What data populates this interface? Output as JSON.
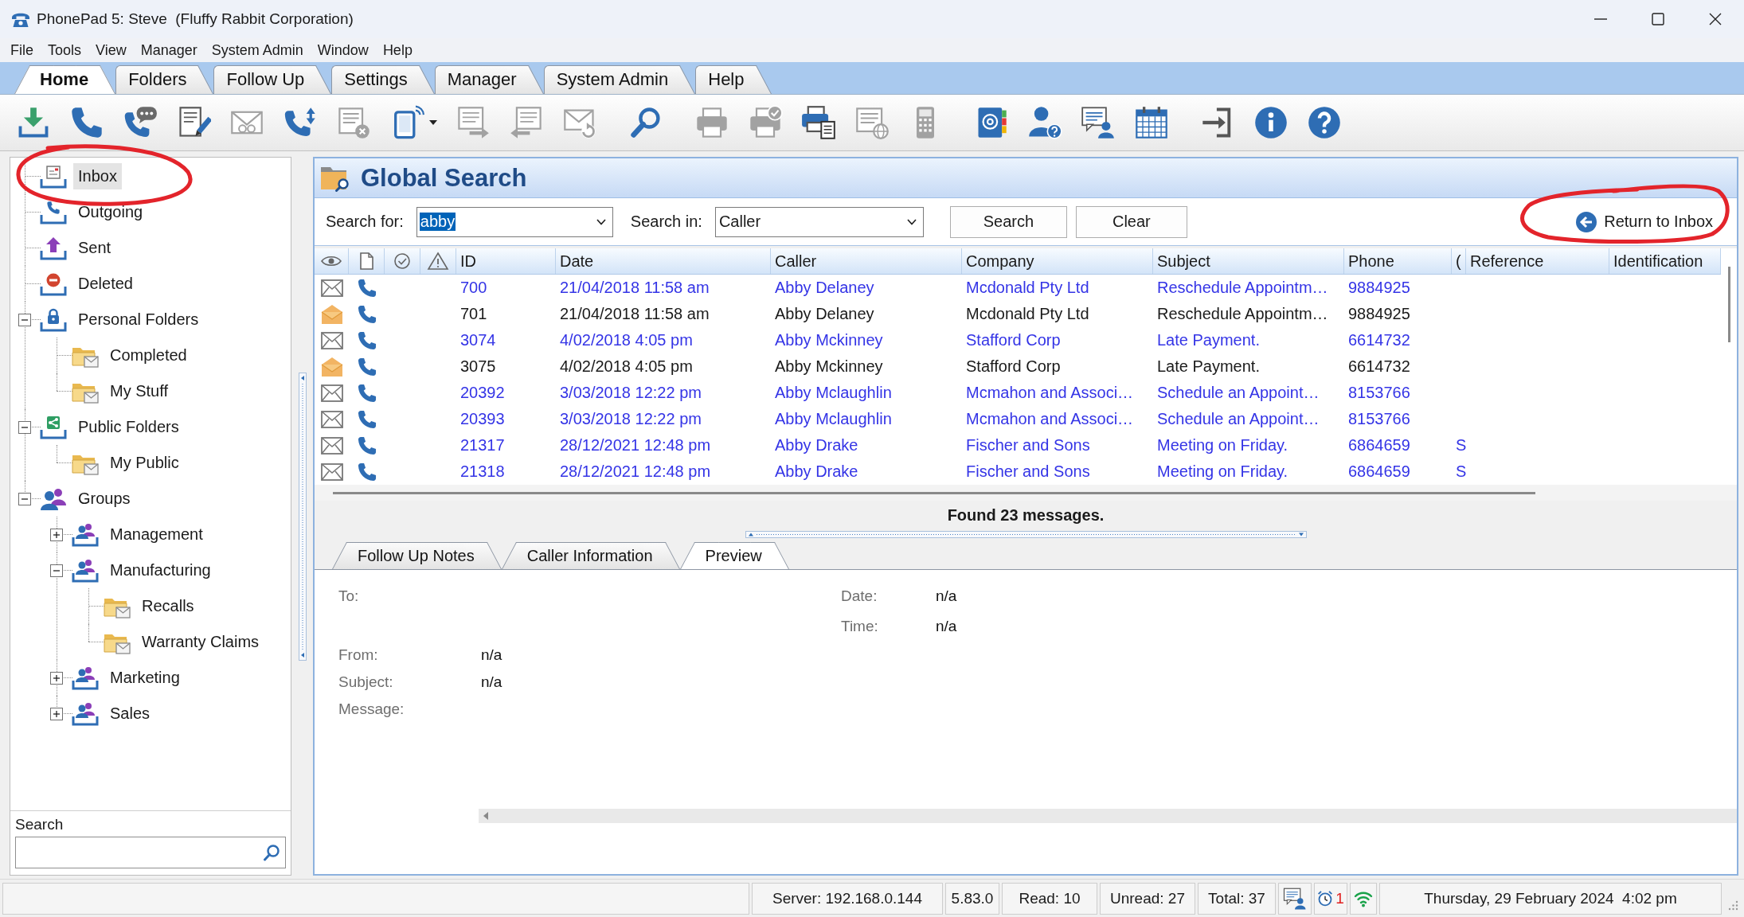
{
  "window": {
    "title": "PhonePad 5: Steve  (Fluffy Rabbit Corporation)"
  },
  "menu": [
    "File",
    "Tools",
    "View",
    "Manager",
    "System Admin",
    "Window",
    "Help"
  ],
  "ribbon_tabs": [
    {
      "label": "Home",
      "selected": true
    },
    {
      "label": "Folders",
      "selected": false
    },
    {
      "label": "Follow Up",
      "selected": false
    },
    {
      "label": "Settings",
      "selected": false
    },
    {
      "label": "Manager",
      "selected": false
    },
    {
      "label": "System Admin",
      "selected": false
    },
    {
      "label": "Help",
      "selected": false
    }
  ],
  "toolbar": {
    "groups": [
      [
        {
          "kind": "download",
          "disabled": false
        },
        {
          "kind": "phone",
          "disabled": false
        },
        {
          "kind": "phone-chat",
          "disabled": false
        },
        {
          "kind": "edit-doc",
          "disabled": false
        },
        {
          "kind": "envelope-glasses",
          "disabled": true
        },
        {
          "kind": "phone-transfer",
          "disabled": false
        },
        {
          "kind": "doc-x",
          "disabled": true
        },
        {
          "kind": "mobile-menu",
          "disabled": false
        },
        {
          "kind": "doc-forward",
          "disabled": true
        },
        {
          "kind": "doc-back",
          "disabled": true
        },
        {
          "kind": "envelope-refresh",
          "disabled": true
        }
      ],
      [
        {
          "kind": "search",
          "disabled": false
        }
      ],
      [
        {
          "kind": "printer",
          "disabled": true
        },
        {
          "kind": "printer-check",
          "disabled": true
        },
        {
          "kind": "printer-doc",
          "disabled": false
        },
        {
          "kind": "doc-globe",
          "disabled": true
        },
        {
          "kind": "calculator",
          "disabled": true
        }
      ],
      [
        {
          "kind": "address-book",
          "disabled": false
        },
        {
          "kind": "person-question",
          "disabled": false
        },
        {
          "kind": "chat-person",
          "disabled": false
        },
        {
          "kind": "calendar",
          "disabled": false
        }
      ],
      [
        {
          "kind": "exit",
          "disabled": false
        },
        {
          "kind": "info",
          "disabled": false
        },
        {
          "kind": "help",
          "disabled": false
        }
      ]
    ]
  },
  "sidebar": {
    "tree": [
      {
        "label": "Inbox",
        "kind": "inbox",
        "selected": true
      },
      {
        "label": "Outgoing",
        "kind": "outgoing",
        "selected": false
      },
      {
        "label": "Sent",
        "kind": "sent",
        "selected": false
      },
      {
        "label": "Deleted",
        "kind": "deleted",
        "selected": false
      },
      {
        "label": "Personal Folders",
        "kind": "personal",
        "selected": false,
        "expanded": true,
        "children": [
          {
            "label": "Completed",
            "kind": "folder",
            "selected": false
          },
          {
            "label": "My Stuff",
            "kind": "folder",
            "selected": false
          }
        ]
      },
      {
        "label": "Public Folders",
        "kind": "public",
        "selected": false,
        "expanded": true,
        "children": [
          {
            "label": "My Public",
            "kind": "folder",
            "selected": false
          }
        ]
      },
      {
        "label": "Groups",
        "kind": "groups",
        "selected": false,
        "expanded": true,
        "children": [
          {
            "label": "Management",
            "kind": "group",
            "selected": false,
            "expanded": false
          },
          {
            "label": "Manufacturing",
            "kind": "group",
            "selected": false,
            "expanded": true,
            "children": [
              {
                "label": "Recalls",
                "kind": "folder",
                "selected": false
              },
              {
                "label": "Warranty Claims",
                "kind": "folder",
                "selected": false
              }
            ]
          },
          {
            "label": "Marketing",
            "kind": "group",
            "selected": false,
            "expanded": false
          },
          {
            "label": "Sales",
            "kind": "group",
            "selected": false,
            "expanded": false
          }
        ]
      }
    ],
    "search": {
      "label": "Search"
    }
  },
  "search": {
    "title": "Global Search",
    "fields": [
      {
        "label": "Search for:",
        "value": "abby",
        "highlighted": true
      },
      {
        "label": "Search in:",
        "value": "Caller",
        "highlighted": false
      }
    ],
    "buttons": [
      "Search",
      "Clear"
    ],
    "link": "Return to Inbox"
  },
  "table": {
    "columns": [
      "ID",
      "Date",
      "Caller",
      "Company",
      "Subject",
      "Phone",
      "(",
      "Reference",
      "Identification"
    ],
    "rows": [
      {
        "read": false,
        "id": "700",
        "date": "21/04/2018 11:58 am",
        "caller": "Abby Delaney",
        "company": "Mcdonald Pty Ltd",
        "subject": "Reschedule Appointm…",
        "phone": "9884925"
      },
      {
        "read": true,
        "id": "701",
        "date": "21/04/2018 11:58 am",
        "caller": "Abby Delaney",
        "company": "Mcdonald Pty Ltd",
        "subject": "Reschedule Appointm…",
        "phone": "9884925"
      },
      {
        "read": false,
        "id": "3074",
        "date": "4/02/2018 4:05 pm",
        "caller": "Abby Mckinney",
        "company": "Stafford Corp",
        "subject": "Late Payment.",
        "phone": "6614732"
      },
      {
        "read": true,
        "id": "3075",
        "date": "4/02/2018 4:05 pm",
        "caller": "Abby Mckinney",
        "company": "Stafford Corp",
        "subject": "Late Payment.",
        "phone": "6614732"
      },
      {
        "read": false,
        "id": "20392",
        "date": "3/03/2018 12:22 pm",
        "caller": "Abby Mclaughlin",
        "company": "Mcmahon and Associ…",
        "subject": "Schedule an Appoint…",
        "phone": "8153766"
      },
      {
        "read": false,
        "id": "20393",
        "date": "3/03/2018 12:22 pm",
        "caller": "Abby Mclaughlin",
        "company": "Mcmahon and Associ…",
        "subject": "Schedule an Appoint…",
        "phone": "8153766"
      },
      {
        "read": false,
        "id": "21317",
        "date": "28/12/2021 12:48 pm",
        "caller": "Abby Drake",
        "company": "Fischer and Sons",
        "subject": "Meeting on Friday.",
        "phone": "6864659",
        "column_7": "S"
      },
      {
        "read": false,
        "id": "21318",
        "date": "28/12/2021 12:48 pm",
        "caller": "Abby Drake",
        "company": "Fischer and Sons",
        "subject": "Meeting on Friday.",
        "phone": "6864659",
        "column_7": "S"
      }
    ]
  },
  "result": "Found 23 messages.",
  "detail_tabs": [
    {
      "label": "Follow Up Notes",
      "selected": false
    },
    {
      "label": "Caller Information",
      "selected": false
    },
    {
      "label": "Preview",
      "selected": true
    }
  ],
  "preview": {
    "left": [
      {
        "label": "To:"
      }
    ],
    "right": [
      {
        "label": "Date:",
        "value": "n/a"
      },
      {
        "label": "Time:",
        "value": "n/a"
      }
    ],
    "fields": [
      {
        "label": "From:",
        "value": "n/a"
      },
      {
        "label": "Subject:",
        "value": "n/a"
      },
      {
        "label": "Message:"
      }
    ]
  },
  "status_bar": {
    "server": "Server: 192.168.0.144",
    "version": "5.83.0",
    "read": "Read: 10",
    "unread": "Unread: 27",
    "total": "Total: 37",
    "alarms": "1",
    "datetime": "Thursday, 29 February 2024  4:02 pm"
  }
}
